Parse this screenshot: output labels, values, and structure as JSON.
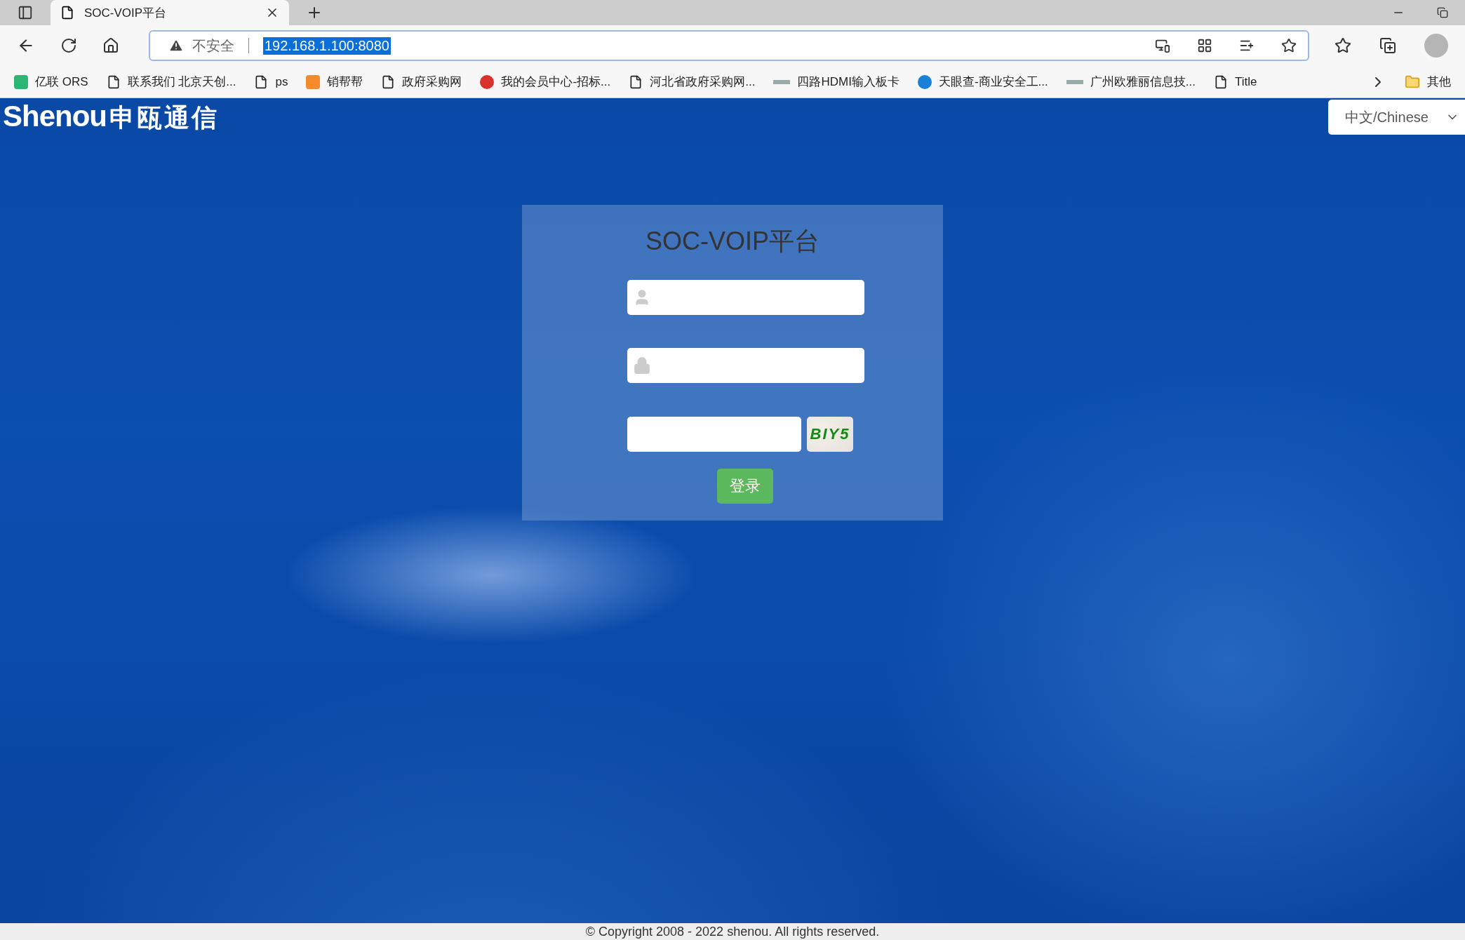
{
  "browser": {
    "tab": {
      "title": "SOC-VOIP平台"
    },
    "security_label": "不安全",
    "url": "192.168.1.100:8080",
    "bookmarks": [
      {
        "kind": "green-app",
        "label": "亿联 ORS"
      },
      {
        "kind": "page",
        "label": "联系我们 北京天创..."
      },
      {
        "kind": "page",
        "label": "ps"
      },
      {
        "kind": "orange-app",
        "label": "销帮帮"
      },
      {
        "kind": "page",
        "label": "政府采购网"
      },
      {
        "kind": "red-app",
        "label": "我的会员中心-招标..."
      },
      {
        "kind": "page",
        "label": "河北省政府采购网..."
      },
      {
        "kind": "thumb",
        "label": "四路HDMI输入板卡"
      },
      {
        "kind": "blue-app",
        "label": "天眼查-商业安全工..."
      },
      {
        "kind": "thumb",
        "label": "广州欧雅丽信息技..."
      },
      {
        "kind": "page",
        "label": "Title"
      }
    ],
    "other_folder": "其他"
  },
  "page": {
    "logo": {
      "latin": "Shenou",
      "chinese": "申瓯通信"
    },
    "language": "中文/Chinese",
    "login": {
      "title": "SOC-VOIP平台",
      "fields": [
        {
          "kind": "user"
        },
        {
          "kind": "password"
        },
        {
          "kind": "captcha"
        }
      ],
      "captcha": "BIY5",
      "button": "登录"
    },
    "footer": "© Copyright 2008 - 2022 shenou. All rights reserved."
  }
}
